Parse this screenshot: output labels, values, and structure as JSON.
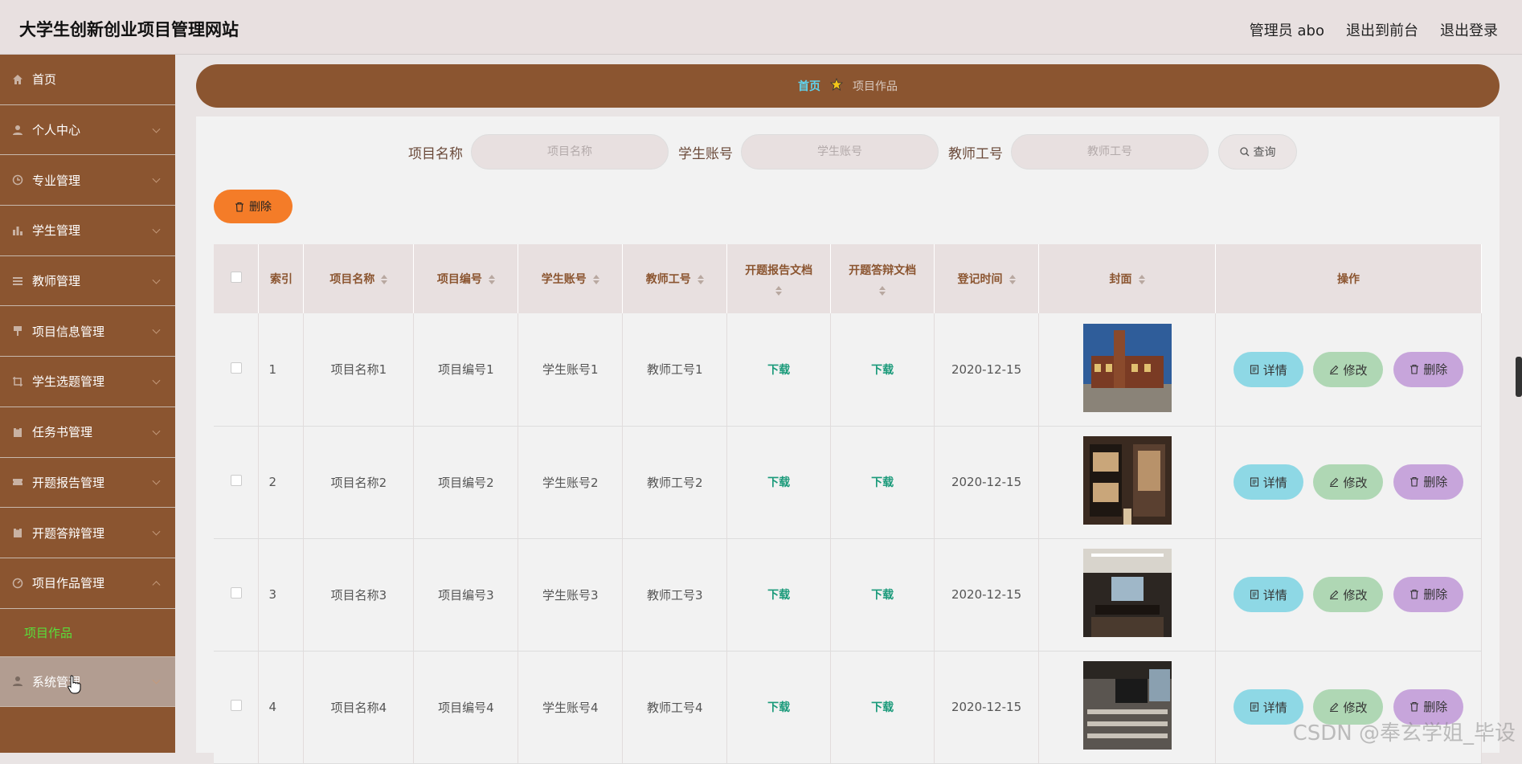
{
  "header": {
    "site_title": "大学生创新创业项目管理网站",
    "admin_label": "管理员 abo",
    "to_frontend": "退出到前台",
    "logout": "退出登录"
  },
  "sidebar": {
    "items": [
      {
        "label": "首页",
        "icon": "home-icon"
      },
      {
        "label": "个人中心",
        "icon": "user-icon"
      },
      {
        "label": "专业管理",
        "icon": "clock-icon"
      },
      {
        "label": "学生管理",
        "icon": "bar-chart-icon"
      },
      {
        "label": "教师管理",
        "icon": "list-icon"
      },
      {
        "label": "项目信息管理",
        "icon": "pin-icon"
      },
      {
        "label": "学生选题管理",
        "icon": "crop-icon"
      },
      {
        "label": "任务书管理",
        "icon": "clipboard-icon"
      },
      {
        "label": "开题报告管理",
        "icon": "ticket-icon"
      },
      {
        "label": "开题答辩管理",
        "icon": "clipboard-icon"
      },
      {
        "label": "项目作品管理",
        "icon": "dashboard-icon"
      },
      {
        "label": "系统管理",
        "icon": "user-icon"
      }
    ],
    "sub_item": "项目作品"
  },
  "breadcrumb": {
    "home": "首页",
    "current": "项目作品"
  },
  "search": {
    "name_label": "项目名称",
    "name_placeholder": "项目名称",
    "student_label": "学生账号",
    "student_placeholder": "学生账号",
    "teacher_label": "教师工号",
    "teacher_placeholder": "教师工号",
    "query_label": "查询"
  },
  "toolbar": {
    "delete_label": "删除"
  },
  "table": {
    "headers": {
      "index": "索引",
      "name": "项目名称",
      "code": "项目编号",
      "student": "学生账号",
      "teacher": "教师工号",
      "report_doc": "开题报告文档",
      "defense_doc": "开题答辩文档",
      "date": "登记时间",
      "cover": "封面",
      "ops": "操作"
    },
    "rows": [
      {
        "index": "1",
        "name": "项目名称1",
        "code": "项目编号1",
        "student": "学生账号1",
        "teacher": "教师工号1",
        "report": "下载",
        "defense": "下载",
        "date": "2020-12-15"
      },
      {
        "index": "2",
        "name": "项目名称2",
        "code": "项目编号2",
        "student": "学生账号2",
        "teacher": "教师工号2",
        "report": "下载",
        "defense": "下载",
        "date": "2020-12-15"
      },
      {
        "index": "3",
        "name": "项目名称3",
        "code": "项目编号3",
        "student": "学生账号3",
        "teacher": "教师工号3",
        "report": "下载",
        "defense": "下载",
        "date": "2020-12-15"
      },
      {
        "index": "4",
        "name": "项目名称4",
        "code": "项目编号4",
        "student": "学生账号4",
        "teacher": "教师工号4",
        "report": "下载",
        "defense": "下载",
        "date": "2020-12-15"
      }
    ],
    "ops": {
      "detail": "详情",
      "edit": "修改",
      "delete": "删除"
    }
  },
  "watermark": "CSDN @奉玄学姐_毕设",
  "colors": {
    "brand": "#8b5530",
    "accent_orange": "#f47c28",
    "link_green": "#1a9a7a"
  }
}
